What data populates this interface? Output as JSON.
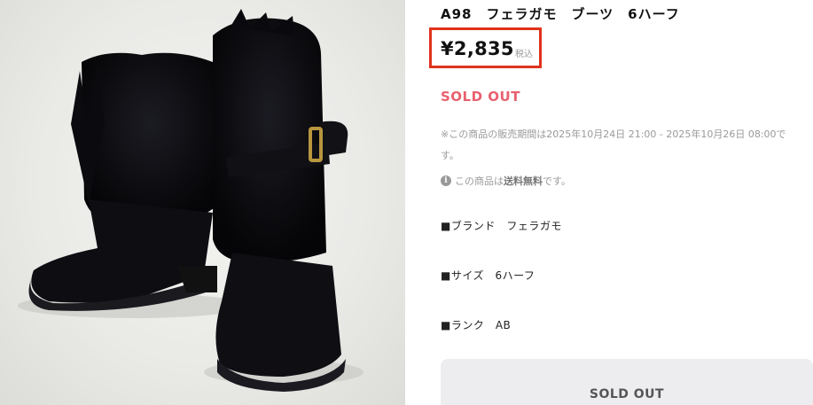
{
  "product": {
    "title": "A98　フェラガモ　ブーツ　6ハーフ",
    "price": "¥2,835",
    "tax_label": "税込",
    "status_label": "SOLD OUT",
    "sale_period": "※この商品の販売期間は2025年10月24日 21:00 - 2025年10月26日 08:00です。",
    "shipping_prefix": "この商品は",
    "shipping_emphasis": "送料無料",
    "shipping_suffix": "です。",
    "info_icon": "info-icon",
    "specs": [
      "■ブランド　フェラガモ",
      "■サイズ　6ハーフ",
      "■ランク　AB"
    ],
    "button_label": "SOLD OUT"
  },
  "colors": {
    "price_highlight": "#e0321c",
    "sold_out_text": "#e8616e",
    "button_bg": "#ededf0"
  }
}
